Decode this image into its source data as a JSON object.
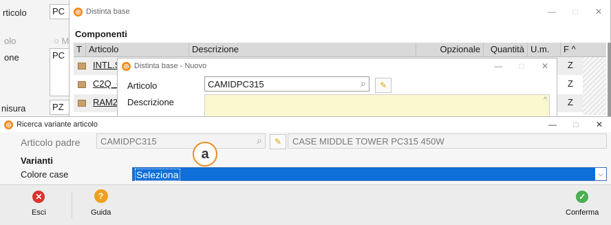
{
  "background_form": {
    "labels": [
      "rticolo",
      "olo",
      "one",
      "nisura"
    ],
    "articolo_value": "PC",
    "radio_label": "M",
    "descr_value": "PC",
    "um_value": "PZ"
  },
  "distinta_window": {
    "title": "Distinta base",
    "section_title": "Componenti",
    "columns": [
      "T",
      "Articolo",
      "Descrizione",
      "Opzionale",
      "Quantità",
      "U.m.",
      "F"
    ],
    "rows": [
      {
        "articolo": "INTL.S",
        "um": "Z"
      },
      {
        "articolo": "C2Q_C",
        "um": "Z"
      },
      {
        "articolo": "RAM2",
        "um": "Z"
      }
    ]
  },
  "nuovo_window": {
    "title": "Distinta base - Nuovo",
    "articolo_label": "Articolo",
    "articolo_value": "CAMIDPC315",
    "descrizione_label": "Descrizione",
    "descrizione_value": ""
  },
  "ricerca_dialog": {
    "title": "Ricerca variante articolo",
    "articolo_padre_label": "Articolo padre",
    "articolo_padre_value": "CAMIDPC315",
    "articolo_padre_desc": "CASE MIDDLE TOWER PC315 450W",
    "varianti_title": "Varianti",
    "colore_label": "Colore case",
    "colore_selected": "Seleziona",
    "annotation_marker": "a",
    "footer": {
      "esci": "Esci",
      "guida": "Guida",
      "conferma": "Conferma"
    }
  },
  "window_controls": {
    "minimize": "—",
    "maximize": "□",
    "close": "✕"
  },
  "colors": {
    "accent_orange": "#f08a1c",
    "select_blue": "#0f6fd8",
    "input_yellow": "#fbf8cf",
    "exit_red": "#d9342b",
    "help_orange": "#f0a020",
    "ok_green": "#4caf50"
  }
}
